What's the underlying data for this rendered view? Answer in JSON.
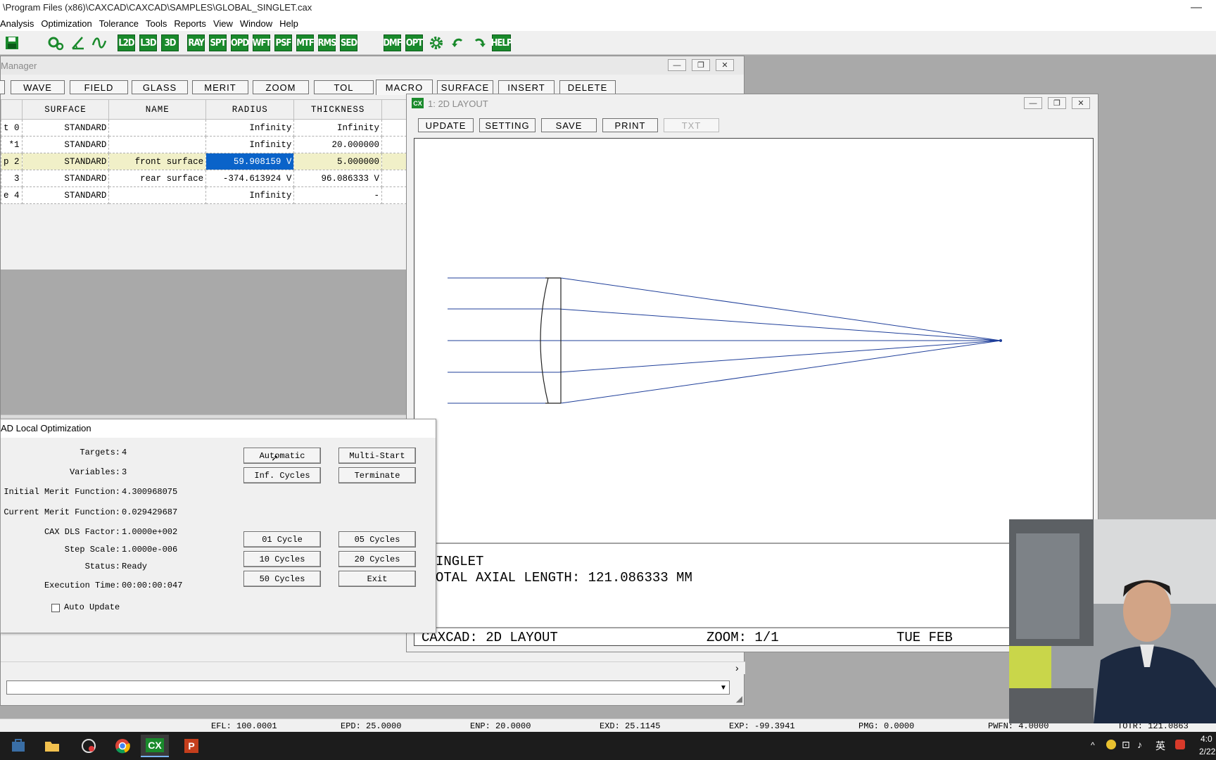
{
  "app": {
    "title": "\\Program Files (x86)\\CAXCAD\\CAXCAD\\SAMPLES\\GLOBAL_SINGLET.cax",
    "min_glyph": "—"
  },
  "menu": [
    "Analysis",
    "Optimization",
    "Tolerance",
    "Tools",
    "Reports",
    "View",
    "Window",
    "Help"
  ],
  "toolbar": {
    "buttons": [
      "L2D",
      "L3D",
      "3D",
      "RAY",
      "SPT",
      "OPD",
      "WFT",
      "PSF",
      "MTF",
      "RMS",
      "SED",
      "DMF",
      "OPT",
      "HELP"
    ],
    "icons": [
      "save-icon",
      "gears-icon",
      "angle-icon",
      "wave-icon",
      "settings-gear-icon",
      "undo-arrow-icon",
      "redo-arrow-icon"
    ]
  },
  "lens_manager": {
    "title": "Manager",
    "tabs": [
      "WAVE",
      "FIELD",
      "GLASS",
      "MERIT",
      "ZOOM",
      "TOL",
      "MACRO",
      "SURFACE",
      "INSERT",
      "DELETE"
    ],
    "columns": [
      "SURFACE",
      "NAME",
      "RADIUS",
      "THICKNESS"
    ],
    "rows": [
      {
        "id": "t 0",
        "surface": "STANDARD",
        "name": "",
        "radius": "Infinity",
        "thickness": "Infinity"
      },
      {
        "id": "*1",
        "surface": "STANDARD",
        "name": "",
        "radius": "Infinity",
        "thickness": "20.000000"
      },
      {
        "id": "p 2",
        "surface": "STANDARD",
        "name": "front surface",
        "radius": "59.908159 V",
        "thickness": "5.000000"
      },
      {
        "id": "3",
        "surface": "STANDARD",
        "name": "rear surface",
        "radius": "-374.613924 V",
        "thickness": "96.086333 V"
      },
      {
        "id": "e 4",
        "surface": "STANDARD",
        "name": "",
        "radius": "Infinity",
        "thickness": "-"
      }
    ],
    "scroll_right": "›"
  },
  "optimization": {
    "title": "AD Local Optimization",
    "fields": [
      {
        "label": "Targets:",
        "value": "4"
      },
      {
        "label": "Variables:",
        "value": "3"
      },
      {
        "label": "Initial Merit Function:",
        "value": "4.300968075"
      },
      {
        "label": "Current Merit Function:",
        "value": "0.029429687"
      },
      {
        "label": "CAX DLS Factor:",
        "value": "1.0000e+002"
      },
      {
        "label": "Step Scale:",
        "value": "1.0000e-006"
      },
      {
        "label": "Status:",
        "value": "Ready"
      },
      {
        "label": "Execution Time:",
        "value": "00:00:00:047"
      }
    ],
    "buttons": {
      "automatic": "Automatic",
      "multi_start": "Multi-Start",
      "inf_cycles": "Inf. Cycles",
      "terminate": "Terminate",
      "cycle_01": "01 Cycle",
      "cycles_05": "05 Cycles",
      "cycles_10": "10 Cycles",
      "cycles_20": "20 Cycles",
      "cycles_50": "50 Cycles",
      "exit": "Exit"
    },
    "auto_update_label": "Auto Update"
  },
  "layout": {
    "title": "1: 2D LAYOUT",
    "icon_label": "CX",
    "buttons": [
      "UPDATE",
      "SETTING",
      "SAVE",
      "PRINT",
      "TXT"
    ],
    "info_line1": "INGLET",
    "info_line2": "OTAL AXIAL LENGTH: 121.086333 MM",
    "footer_left": "CAXCAD: 2D LAYOUT",
    "footer_zoom": "ZOOM: 1/1",
    "footer_date": "TUE FEB",
    "ray_color": "#1f3f9a"
  },
  "statusbar": [
    "EFL: 100.0001",
    "EPD: 25.0000",
    "ENP: 20.0000",
    "EXD: 25.1145",
    "EXP: -99.3941",
    "PMG: 0.0000",
    "PWFN: 4.0000",
    "TOTR: 121.0863"
  ],
  "tray": {
    "lang": "英",
    "time": "4:0",
    "date": "2/22"
  },
  "taskbar_icons": [
    "windows-store-icon",
    "file-explorer-icon",
    "app-icon",
    "chrome-icon",
    "caxcad-icon",
    "powerpoint-icon"
  ],
  "colors": {
    "accent_green": "#1a8a2c",
    "selection_blue": "#0a63c9",
    "row_highlight": "#f1f0c8"
  }
}
